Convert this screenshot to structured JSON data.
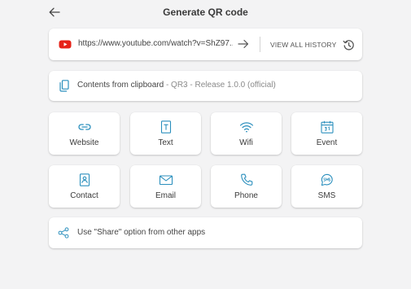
{
  "header": {
    "title": "Generate QR code",
    "back_icon": "arrow-left-icon"
  },
  "url_bar": {
    "icon": "youtube-icon",
    "value": "https://www.youtube.com/watch?v=ShZ97...",
    "go_icon": "arrow-right-icon",
    "history_label": "VIEW ALL HISTORY",
    "history_icon": "history-icon"
  },
  "clipboard": {
    "icon": "clipboard-icon",
    "label": "Contents from clipboard",
    "detail": " - QR3 - Release 1.0.0 (official)"
  },
  "types": [
    {
      "label": "Website",
      "icon": "link-icon"
    },
    {
      "label": "Text",
      "icon": "text-icon"
    },
    {
      "label": "Wifi",
      "icon": "wifi-icon"
    },
    {
      "label": "Event",
      "icon": "calendar-icon"
    },
    {
      "label": "Contact",
      "icon": "contact-icon"
    },
    {
      "label": "Email",
      "icon": "email-icon"
    },
    {
      "label": "Phone",
      "icon": "phone-icon"
    },
    {
      "label": "SMS",
      "icon": "sms-icon"
    }
  ],
  "share": {
    "icon": "share-icon",
    "label": "Use \"Share\" option from other apps"
  },
  "colors": {
    "accent": "#2b8fbd",
    "youtube": "#e62117",
    "background": "#f3f3f4"
  }
}
